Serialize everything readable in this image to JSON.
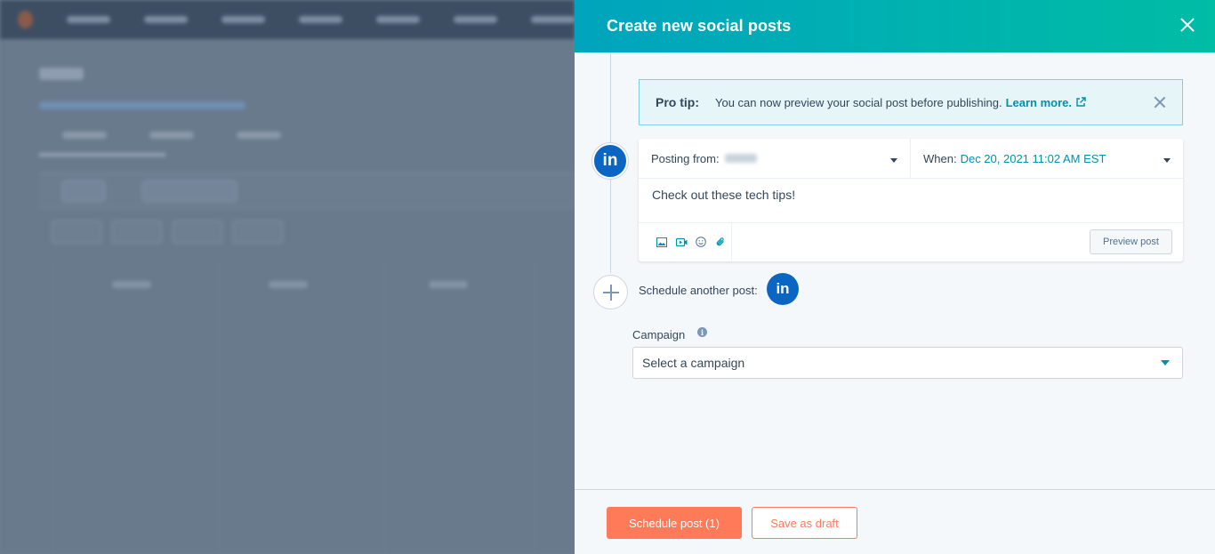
{
  "panel": {
    "title": "Create new social posts"
  },
  "protip": {
    "label": "Pro tip:",
    "text": "You can now preview your social post before publishing.",
    "link": "Learn more."
  },
  "post": {
    "network_icon": "in",
    "posting_from_label": "Posting from:",
    "when_label": "When:",
    "when_value": "Dec 20, 2021 11:02 AM EST",
    "body": "Check out these tech tips!",
    "preview_button": "Preview post"
  },
  "schedule_another": {
    "label": "Schedule another post:",
    "network_icon": "in"
  },
  "campaign": {
    "label": "Campaign",
    "placeholder": "Select a campaign"
  },
  "footer": {
    "schedule_button": "Schedule post (1)",
    "draft_button": "Save as draft"
  },
  "colors": {
    "header_gradient_start": "#00a4bd",
    "header_gradient_end": "#00bda5",
    "primary_orange": "#ff7a59",
    "link_teal": "#0091ae",
    "linkedin_blue": "#0a66c2",
    "text_dark": "#33475b"
  }
}
